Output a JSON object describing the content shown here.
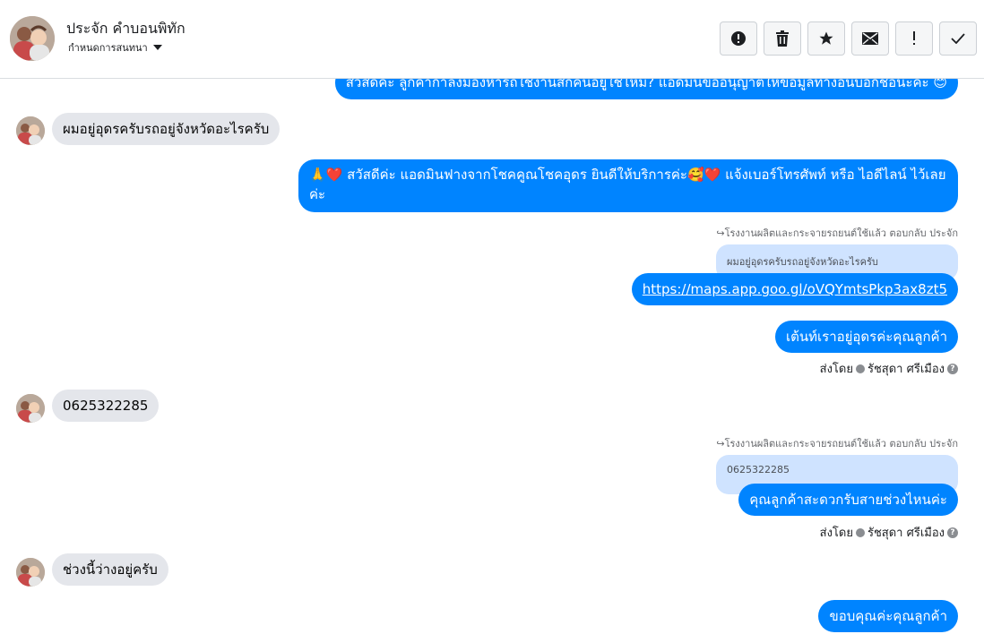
{
  "header": {
    "contact_name": "ประจัก คำบอนพิทัก",
    "assign_label": "กำหนดการสนทนา",
    "toolbar": [
      {
        "name": "spam-button",
        "icon": "alert-circle-icon"
      },
      {
        "name": "delete-button",
        "icon": "trash-icon"
      },
      {
        "name": "star-button",
        "icon": "star-icon"
      },
      {
        "name": "mark-unread-button",
        "icon": "envelope-icon"
      },
      {
        "name": "follow-up-button",
        "icon": "exclamation-icon"
      },
      {
        "name": "mark-done-button",
        "icon": "check-icon"
      }
    ]
  },
  "messages": {
    "m1_partial": "สวัสดีค่ะ ลูกค้ากำลังมองหารถใช้งานสักคันอยู่ใช่ไหม? แอดมินขออนุญาตให้ข้อมูลทางอื่นบอกชื่อนะคะ 😊",
    "m2": "ผมอยู่อุดรครับรถอยู่จังหวัดอะไรครับ",
    "m3_line1": "🙏❤️ สวัสดีค่ะ แอดมินฟางจากโชคคูณโชคอุดร ยินดีให้บริการค่ะ🥰❤️ แจ้งเบอร์โทรศัพท์ หรือ ไอดีไลน์  ไว้เลย",
    "m3_line2": "ค่ะ",
    "reply1_meta": "↪โรงงานผลิตและกระจายรถยนต์ใช้แล้ว ตอบกลับ ประจัก",
    "reply1_quote": "ผมอยู่อุดรครับรถอยู่จังหวัดอะไรครับ",
    "m4_link": "https://maps.app.goo.gl/oVQYmtsPkp3ax8zt5",
    "m5": "เต้นท์เราอยู่อุดรค่ะคุณลูกค้า",
    "sent_by_label": "ส่งโดย",
    "sent_by_name": "รัชสุดา ศรีเมือง",
    "m6": "0625322285",
    "reply2_meta": "↪โรงงานผลิตและกระจายรถยนต์ใช้แล้ว ตอบกลับ ประจัก",
    "reply2_quote": "0625322285",
    "m7": "คุณลูกค้าสะดวกรับสายช่วงไหนค่ะ",
    "m8": "ช่วงนี้ว่างอยู่ครับ",
    "m9_partial": "ขอบคุณค่ะคุณลูกค้า"
  },
  "colors": {
    "outgoing": "#0084ff",
    "incoming": "#e4e6eb",
    "quote": "#cfe3ff"
  }
}
